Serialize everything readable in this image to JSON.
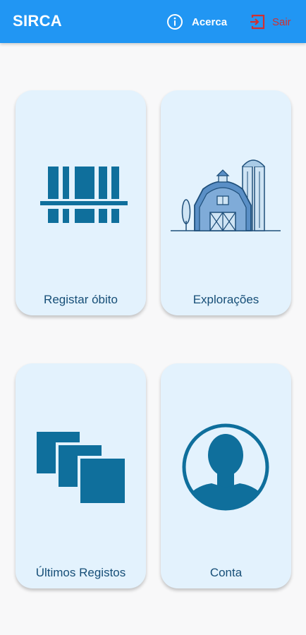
{
  "app": {
    "title": "SIRCA"
  },
  "toolbar": {
    "about_label": "Acerca",
    "exit_label": "Sair",
    "about_icon": "info-icon",
    "exit_icon": "exit-icon"
  },
  "menu": {
    "items": [
      {
        "label": "Registar óbito",
        "icon": "barcode-icon"
      },
      {
        "label": "Explorações",
        "icon": "farm-barn-icon"
      },
      {
        "label": "Últimos Registos",
        "icon": "stacked-squares-icon"
      },
      {
        "label": "Conta",
        "icon": "user-account-icon"
      }
    ]
  },
  "colors": {
    "appbar": "#2196f3",
    "card_background": "#e3f2fd",
    "icon_primary": "#0f6f9c",
    "label": "#164e77",
    "exit": "#d32f2f"
  }
}
